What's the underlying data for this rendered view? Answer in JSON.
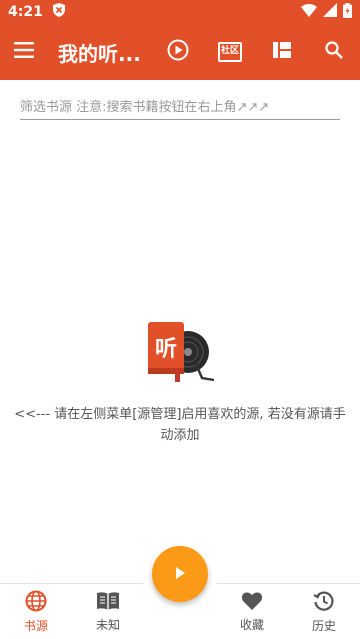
{
  "status_bar": {
    "time": "4:21"
  },
  "toolbar": {
    "title": "我的听...",
    "icons": [
      "menu-icon",
      "play-circle-icon",
      "community-icon",
      "layout-icon",
      "search-icon"
    ],
    "community_label": "社区"
  },
  "filter": {
    "placeholder": "筛选书源 注意:搜索书籍按钮在右上角↗↗↗"
  },
  "empty_state": {
    "icon_label": "听",
    "message": "<<--- 请在左侧菜单[源管理]启用喜欢的源, 若没有源请手动添加"
  },
  "bottom_nav": {
    "items": [
      {
        "label": "书源",
        "icon": "globe-icon",
        "active": true
      },
      {
        "label": "未知",
        "icon": "book-icon",
        "active": false
      },
      {
        "label": "收藏",
        "icon": "heart-icon",
        "active": false
      },
      {
        "label": "历史",
        "icon": "history-icon",
        "active": false
      }
    ]
  },
  "colors": {
    "primary": "#e2502a",
    "fab": "#fb9a17"
  }
}
